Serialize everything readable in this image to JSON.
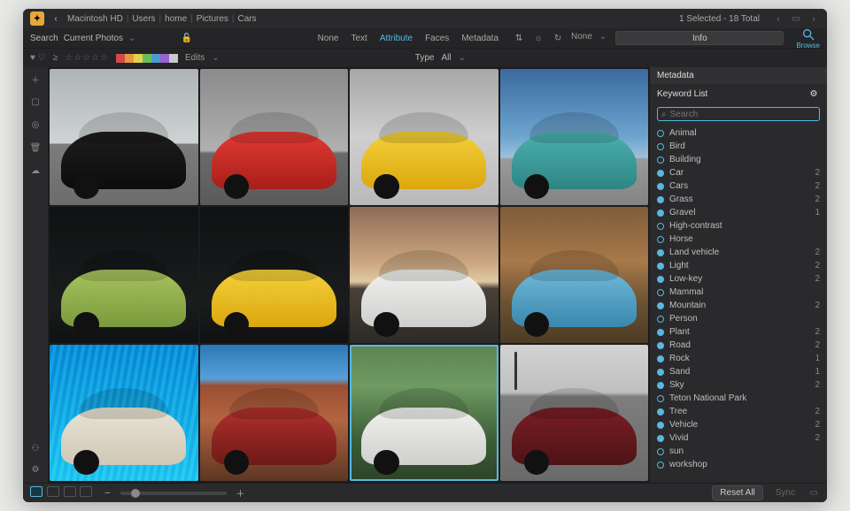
{
  "breadcrumb": [
    "Macintosh HD",
    "Users",
    "home",
    "Pictures",
    "Cars"
  ],
  "status": "1 Selected - 18 Total",
  "search": {
    "label": "Search",
    "scope": "Current Photos"
  },
  "filter_tabs": {
    "none": "None",
    "text": "Text",
    "attribute": "Attribute",
    "faces": "Faces",
    "metadata": "Metadata",
    "active": "attribute"
  },
  "sort": {
    "edits_label": "Edits",
    "type_label": "Type",
    "type_value": "All",
    "none_label": "None"
  },
  "info_button": "Info",
  "browse_label": "Browse",
  "panel": {
    "metadata_hdr": "Metadata",
    "keyword_hdr": "Keyword List",
    "search_placeholder": "Search"
  },
  "swatch_colors": [
    "#d24b4b",
    "#e69a3e",
    "#e6d24a",
    "#6bbf5b",
    "#4b9bd2",
    "#9762d1",
    "#c8c8c8"
  ],
  "keywords": [
    {
      "label": "Animal",
      "on": false,
      "count": ""
    },
    {
      "label": "Bird",
      "on": false,
      "count": ""
    },
    {
      "label": "Building",
      "on": false,
      "count": ""
    },
    {
      "label": "Car",
      "on": true,
      "count": "2"
    },
    {
      "label": "Cars",
      "on": true,
      "count": "2"
    },
    {
      "label": "Grass",
      "on": true,
      "count": "2"
    },
    {
      "label": "Gravel",
      "on": true,
      "count": "1"
    },
    {
      "label": "High-contrast",
      "on": false,
      "count": ""
    },
    {
      "label": "Horse",
      "on": false,
      "count": ""
    },
    {
      "label": "Land vehicle",
      "on": true,
      "count": "2"
    },
    {
      "label": "Light",
      "on": true,
      "count": "2"
    },
    {
      "label": "Low-key",
      "on": true,
      "count": "2"
    },
    {
      "label": "Mammal",
      "on": false,
      "count": ""
    },
    {
      "label": "Mountain",
      "on": true,
      "count": "2"
    },
    {
      "label": "Person",
      "on": false,
      "count": ""
    },
    {
      "label": "Plant",
      "on": true,
      "count": "2"
    },
    {
      "label": "Road",
      "on": true,
      "count": "2"
    },
    {
      "label": "Rock",
      "on": true,
      "count": "1"
    },
    {
      "label": "Sand",
      "on": true,
      "count": "1"
    },
    {
      "label": "Sky",
      "on": true,
      "count": "2"
    },
    {
      "label": "Teton National Park",
      "on": false,
      "count": ""
    },
    {
      "label": "Tree",
      "on": true,
      "count": "2"
    },
    {
      "label": "Vehicle",
      "on": true,
      "count": "2"
    },
    {
      "label": "Vivid",
      "on": true,
      "count": "2"
    },
    {
      "label": "sun",
      "on": false,
      "count": ""
    },
    {
      "label": "workshop",
      "on": false,
      "count": ""
    }
  ],
  "thumbs": [
    {
      "scene": "scene-road",
      "car": "c-black",
      "sel": false
    },
    {
      "scene": "scene-gray",
      "car": "c-red",
      "sel": false
    },
    {
      "scene": "scene-hang",
      "car": "c-yellow",
      "sel": false
    },
    {
      "scene": "scene-sky",
      "car": "c-teal",
      "sel": false
    },
    {
      "scene": "scene-dark",
      "car": "c-green",
      "sel": false
    },
    {
      "scene": "scene-dark",
      "car": "c-yellow",
      "sel": false
    },
    {
      "scene": "scene-sunset",
      "car": "c-white",
      "sel": false
    },
    {
      "scene": "scene-autumn",
      "car": "c-blue",
      "sel": false
    },
    {
      "scene": "scene-roof",
      "car": "c-cream",
      "sel": false
    },
    {
      "scene": "scene-rock",
      "car": "c-darkred",
      "sel": false
    },
    {
      "scene": "scene-green",
      "car": "c-white",
      "sel": true
    },
    {
      "scene": "scene-park",
      "car": "c-maroon",
      "sel": false
    }
  ],
  "bottom": {
    "reset": "Reset All",
    "sync": "Sync"
  }
}
